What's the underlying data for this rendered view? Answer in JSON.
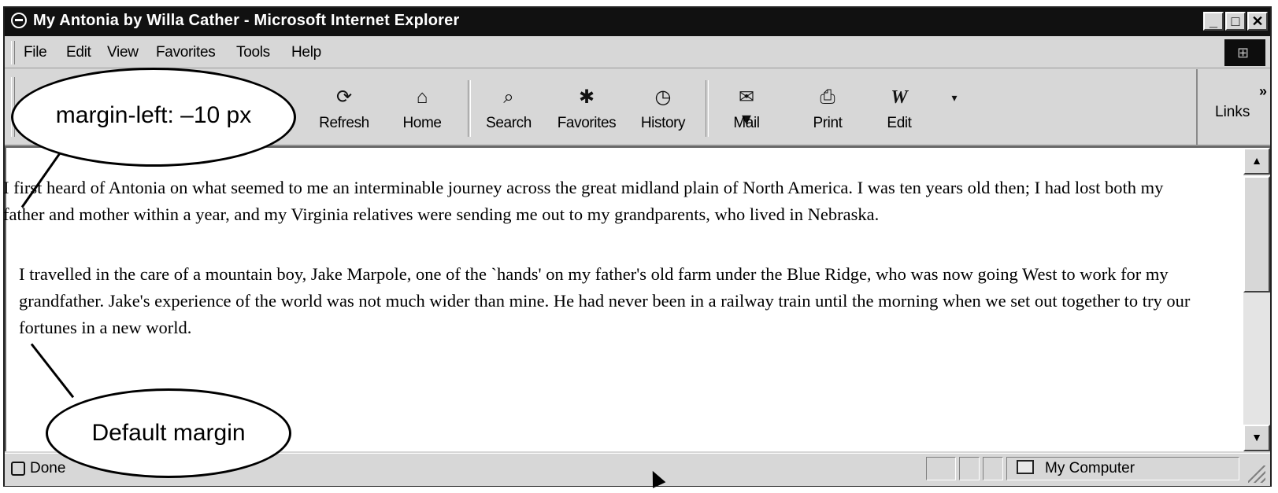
{
  "window": {
    "title": "My Antonia by Willa Cather - Microsoft Internet Explorer",
    "controls": {
      "minimize": "_",
      "maximize": "□",
      "close": "✕"
    }
  },
  "menu": [
    "File",
    "Edit",
    "View",
    "Favorites",
    "Tools",
    "Help"
  ],
  "toolbar": {
    "buttons": [
      {
        "label": "Refresh",
        "icon": "refresh-icon"
      },
      {
        "label": "Home",
        "icon": "home-icon"
      },
      {
        "label": "Search",
        "icon": "search-icon"
      },
      {
        "label": "Favorites",
        "icon": "favorites-icon"
      },
      {
        "label": "History",
        "icon": "history-icon"
      },
      {
        "label": "Mail",
        "icon": "mail-icon"
      },
      {
        "label": "Print",
        "icon": "print-icon"
      },
      {
        "label": "Edit",
        "icon": "edit-icon"
      }
    ],
    "links_label": "Links",
    "links_chevron": "»"
  },
  "content": {
    "paragraphs": [
      "I first heard of Antonia on what seemed to me an interminable journey across the great midland plain of North America. I was ten years old then; I had lost both my father and mother within a year, and my Virginia relatives were sending me out to my grandparents, who lived in Nebraska.",
      "I travelled in the care of a mountain boy, Jake Marpole, one of the `hands' on my father's old farm under the Blue Ridge, who was now going West to work for my grandfather. Jake's experience of the world was not much wider than mine. He had never been in a railway train until the morning when we set out together to try our fortunes in a new world."
    ]
  },
  "status": {
    "text": "Done",
    "zone": "My Computer"
  },
  "annotations": {
    "margin_left": "margin-left: –10 px",
    "default_margin": "Default margin"
  }
}
